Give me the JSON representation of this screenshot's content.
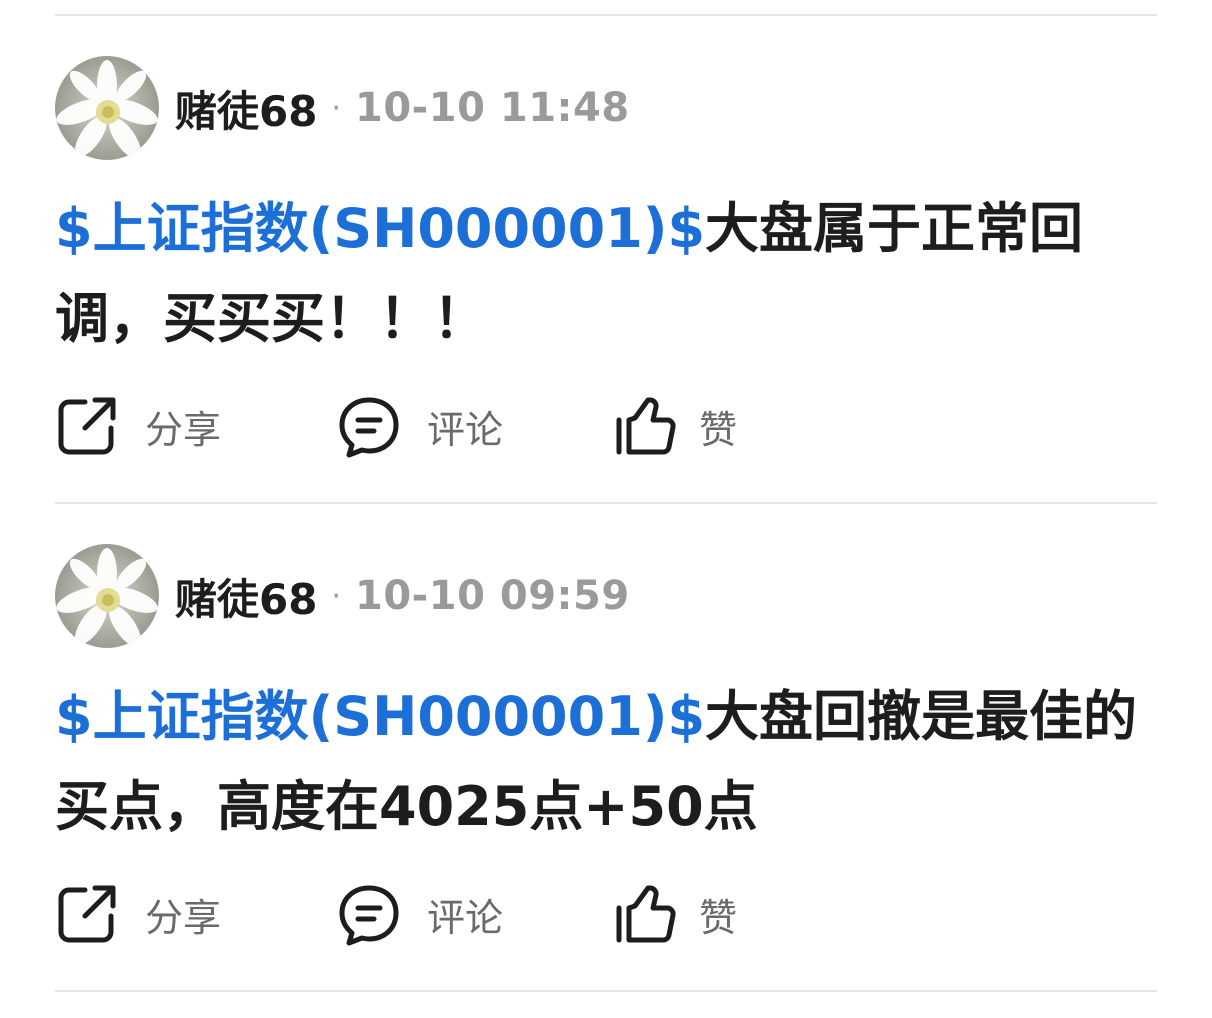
{
  "posts": [
    {
      "username": "赌徒68",
      "separator": "·",
      "timestamp": "10-10 11:48",
      "stock_tag": "$上证指数(SH000001)$",
      "text": "大盘属于正常回调，买买买！！！"
    },
    {
      "username": "赌徒68",
      "separator": "·",
      "timestamp": "10-10 09:59",
      "stock_tag": "$上证指数(SH000001)$",
      "text": "大盘回撤是最佳的买点，高度在4025点+50点"
    }
  ],
  "actions": {
    "share_label": "分享",
    "comment_label": "评论",
    "like_label": "赞",
    "share_icon": "share-icon",
    "comment_icon": "comment-icon",
    "like_icon": "thumbs-up-icon"
  },
  "colors": {
    "stock_link": "#1b6fd6",
    "text": "#1d1d1f",
    "muted": "#9a9a9a",
    "action_label": "#6a6a6a",
    "divider": "#e6e6e6"
  }
}
